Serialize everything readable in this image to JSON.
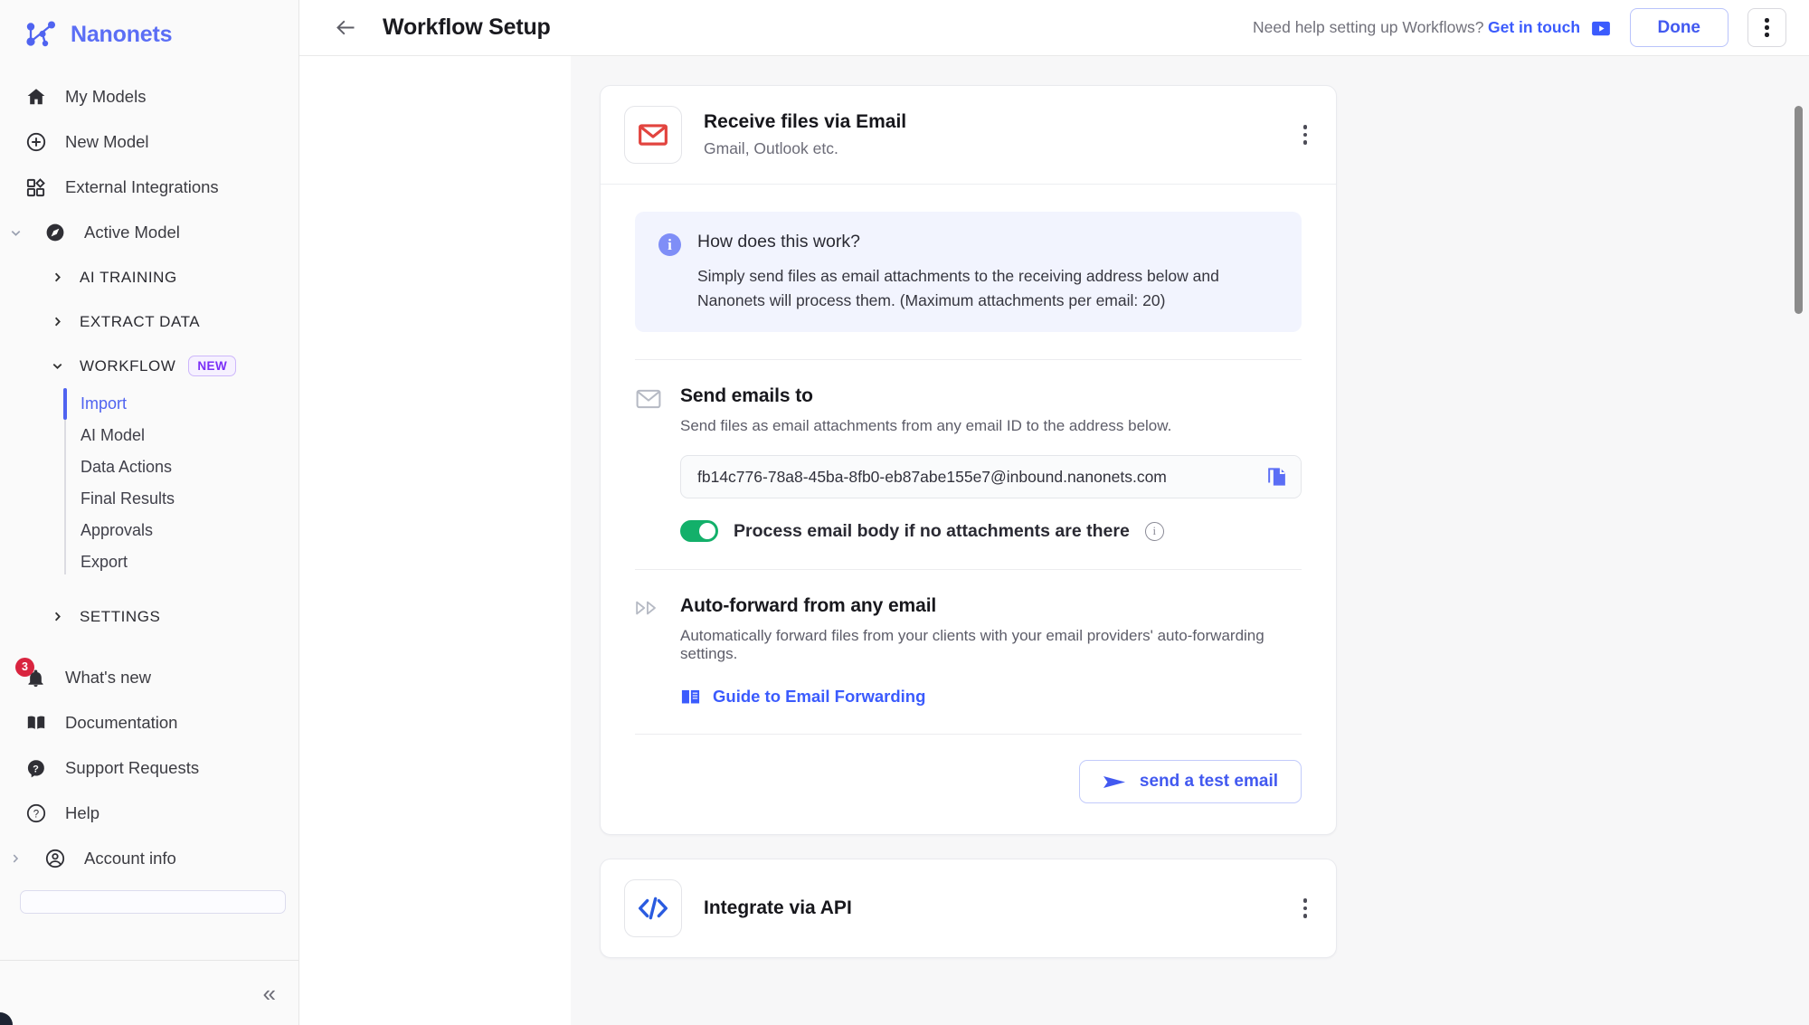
{
  "brand": {
    "name": "Nanonets",
    "logo_icon": "nanonets-logo-icon"
  },
  "sidebar": {
    "primary_items": [
      {
        "label": "My Models",
        "icon": "home-icon"
      },
      {
        "label": "New Model",
        "icon": "plus-circle-icon"
      },
      {
        "label": "External Integrations",
        "icon": "integrations-grid-icon"
      },
      {
        "label": "Active Model",
        "icon": "compass-icon",
        "caret": "chevron-down-icon"
      }
    ],
    "groups": [
      {
        "label": "AI TRAINING",
        "caret": "chevron-right-icon",
        "badge": ""
      },
      {
        "label": "EXTRACT DATA",
        "caret": "chevron-right-icon",
        "badge": ""
      },
      {
        "label": "WORKFLOW",
        "caret": "chevron-down-icon",
        "badge": "NEW"
      }
    ],
    "workflow_items": [
      {
        "label": "Import",
        "active": true
      },
      {
        "label": "AI Model",
        "active": false
      },
      {
        "label": "Data Actions",
        "active": false
      },
      {
        "label": "Final Results",
        "active": false
      },
      {
        "label": "Approvals",
        "active": false
      },
      {
        "label": "Export",
        "active": false
      }
    ],
    "settings_group": {
      "label": "SETTINGS",
      "caret": "chevron-right-icon"
    },
    "bottom_items": [
      {
        "label": "What's new",
        "icon": "bell-icon",
        "badge": "3"
      },
      {
        "label": "Documentation",
        "icon": "book-icon",
        "badge": ""
      },
      {
        "label": "Support Requests",
        "icon": "question-chat-icon",
        "badge": ""
      },
      {
        "label": "Help",
        "icon": "question-circle-icon",
        "badge": ""
      },
      {
        "label": "Account info",
        "icon": "account-circle-icon",
        "badge": "",
        "caret": "chevron-right-icon"
      }
    ],
    "collapse_icon": "double-chevron-left-icon"
  },
  "topbar": {
    "back_icon": "arrow-left-icon",
    "title": "Workflow Setup",
    "help_text": "Need help setting up Workflows?",
    "help_link": "Get in touch",
    "chat_icon": "chat-bubble-icon",
    "done_label": "Done",
    "kebab_icon": "more-vertical-icon"
  },
  "email_card": {
    "icon": "gmail-envelope-icon",
    "title": "Receive files via Email",
    "subtitle": "Gmail, Outlook etc.",
    "kebab_icon": "more-vertical-icon",
    "info": {
      "icon": "info-icon",
      "title": "How does this work?",
      "body": "Simply send files as email attachments to the receiving address below and Nanonets will process them. (Maximum attachments per email: 20)"
    },
    "send_section": {
      "icon": "envelope-outline-icon",
      "title": "Send emails to",
      "desc": "Send files as email attachments from any email ID to the address below.",
      "email_address": "fb14c776-78a8-45ba-8fb0-eb87abe155e7@inbound.nanonets.com",
      "copy_icon": "copy-icon",
      "toggle_label": "Process email body if no attachments are there",
      "toggle_on": true,
      "toggle_info_icon": "info-circle-icon"
    },
    "forward_section": {
      "icon": "fast-forward-icon",
      "title": "Auto-forward from any email",
      "desc": "Automatically forward files from your clients with your email providers' auto-forwarding settings.",
      "guide_icon": "book-open-icon",
      "guide_label": "Guide to Email Forwarding"
    },
    "test_button": {
      "label": "send a test email",
      "icon": "send-plane-icon"
    }
  },
  "api_card": {
    "icon": "code-brackets-icon",
    "title": "Integrate via API",
    "kebab_icon": "more-vertical-icon"
  },
  "colors": {
    "accent": "#4f63f0",
    "brand": "#5b6ef5",
    "toggle_on": "#13b06a",
    "badge_new": "#7b2ff7",
    "badge_count": "#d9243f",
    "gmail_red": "#e2443f",
    "api_blue": "#2a5be0"
  }
}
